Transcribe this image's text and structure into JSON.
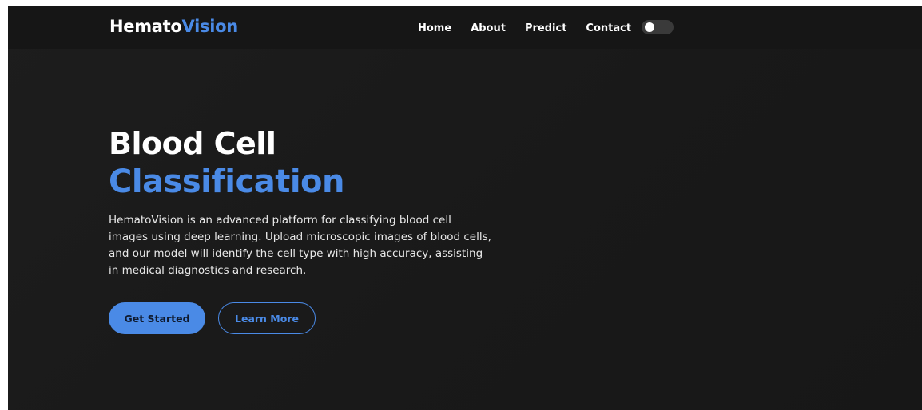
{
  "navbar": {
    "brand_part1": "Hemato",
    "brand_part2": "Vision",
    "links": [
      "Home",
      "About",
      "Predict",
      "Contact"
    ],
    "theme_toggle": {
      "state": "off"
    }
  },
  "hero": {
    "title_line1": "Blood Cell",
    "title_line2": "Classification",
    "description": "HematoVision is an advanced platform for classifying blood cell images using deep learning. Upload microscopic images of blood cells, and our model will identify the cell type with high accuracy, assisting in medical diagnostics and research.",
    "primary_button": "Get Started",
    "secondary_button": "Learn More"
  },
  "colors": {
    "background": "#1a1a1a",
    "navbar": "#161616",
    "accent": "#4a8ae6",
    "text": "#ffffff"
  }
}
